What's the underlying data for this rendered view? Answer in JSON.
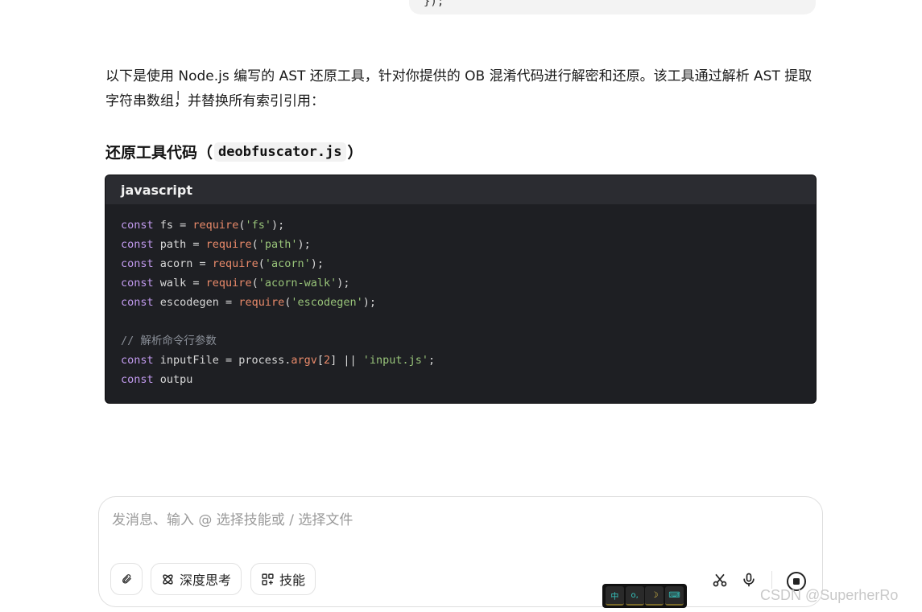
{
  "previous_message": {
    "tail_text": "});"
  },
  "answer": {
    "paragraph": "以下是使用 Node.js 编写的 AST 还原工具，针对你提供的 OB 混淆代码进行解密和还原。该工具通过解析 AST 提取字符串数组，并替换所有索引引用：",
    "heading_prefix": "还原工具代码（",
    "heading_code": "deobfuscator.js",
    "heading_suffix": "）"
  },
  "code_block": {
    "language": "javascript",
    "lines": [
      [
        [
          "kw",
          "const"
        ],
        [
          "p",
          " fs = "
        ],
        [
          "fn",
          "require"
        ],
        [
          "p",
          "("
        ],
        [
          "str",
          "'fs'"
        ],
        [
          "p",
          ");"
        ]
      ],
      [
        [
          "kw",
          "const"
        ],
        [
          "p",
          " path = "
        ],
        [
          "fn",
          "require"
        ],
        [
          "p",
          "("
        ],
        [
          "str",
          "'path'"
        ],
        [
          "p",
          ");"
        ]
      ],
      [
        [
          "kw",
          "const"
        ],
        [
          "p",
          " acorn = "
        ],
        [
          "fn",
          "require"
        ],
        [
          "p",
          "("
        ],
        [
          "str",
          "'acorn'"
        ],
        [
          "p",
          ");"
        ]
      ],
      [
        [
          "kw",
          "const"
        ],
        [
          "p",
          " walk = "
        ],
        [
          "fn",
          "require"
        ],
        [
          "p",
          "("
        ],
        [
          "str",
          "'acorn-walk'"
        ],
        [
          "p",
          ");"
        ]
      ],
      [
        [
          "kw",
          "const"
        ],
        [
          "p",
          " escodegen = "
        ],
        [
          "fn",
          "require"
        ],
        [
          "p",
          "("
        ],
        [
          "str",
          "'escodegen'"
        ],
        [
          "p",
          ");"
        ]
      ],
      [],
      [
        [
          "cm",
          "// 解析命令行参数"
        ]
      ],
      [
        [
          "kw",
          "const"
        ],
        [
          "p",
          " inputFile = process."
        ],
        [
          "fn",
          "argv"
        ],
        [
          "p",
          "["
        ],
        [
          "num",
          "2"
        ],
        [
          "p",
          "] || "
        ],
        [
          "str",
          "'input.js'"
        ],
        [
          "p",
          ";"
        ]
      ],
      [
        [
          "kw",
          "const"
        ],
        [
          "p",
          " outpu"
        ]
      ]
    ]
  },
  "composer": {
    "placeholder": "发消息、输入 @ 选择技能或 / 选择文件",
    "value": "",
    "deep_think_label": "深度思考",
    "skills_label": "技能"
  },
  "ime_toolbar": {
    "keys": [
      "中",
      "o,",
      "☽",
      "⌨"
    ]
  },
  "watermark": "CSDN @SuperherRo",
  "colors": {
    "keyword": "#c39bf0",
    "function": "#e98a6a",
    "string": "#98c379",
    "comment": "#8a8f98",
    "code_bg": "#1e1f23"
  }
}
